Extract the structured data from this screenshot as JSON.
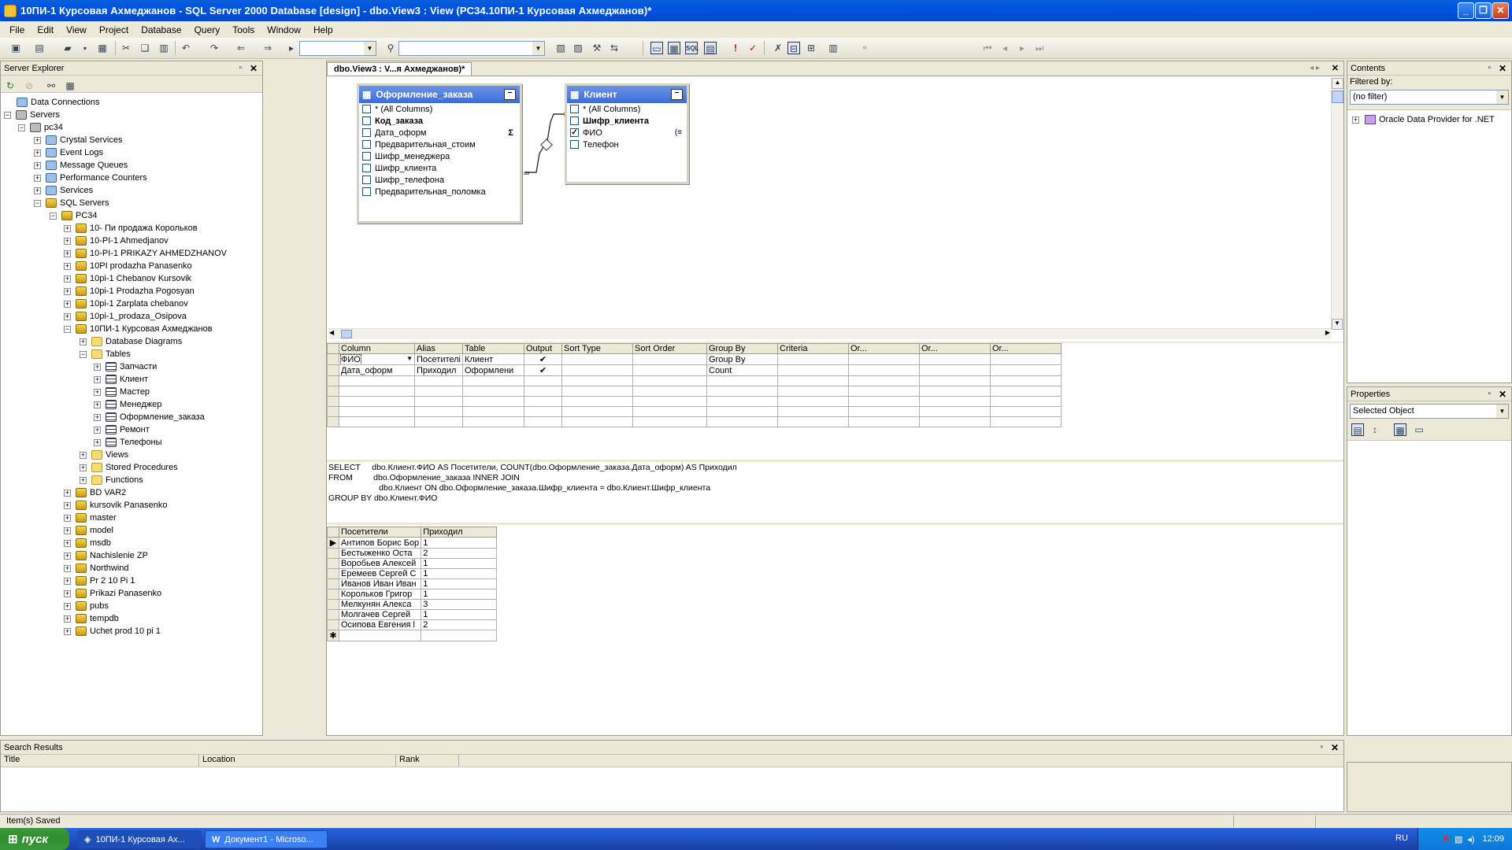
{
  "window": {
    "title": "10ПИ-1 Курсовая Ахмеджанов - SQL Server 2000 Database [design] - dbo.View3 : View (PC34.10ПИ-1 Курсовая Ахмеджанов)*"
  },
  "menu": [
    "File",
    "Edit",
    "View",
    "Project",
    "Database",
    "Query",
    "Tools",
    "Window",
    "Help"
  ],
  "server_explorer": {
    "title": "Server Explorer",
    "nodes": {
      "data_connections": "Data Connections",
      "servers": "Servers",
      "pc34": "pc34",
      "crystal": "Crystal Services",
      "event_logs": "Event Logs",
      "message_queues": "Message Queues",
      "perf": "Performance Counters",
      "services": "Services",
      "sql_servers": "SQL Servers",
      "pc34_inst": "PC34",
      "db1": "10- Пи продажа Корольков",
      "db2": "10-PI-1 Ahmedjanov",
      "db3": "10-PI-1 PRIKAZY AHMEDZHANOV",
      "db4": "10PI prodazha Panasenko",
      "db5": "10pi-1 Chebanov Kursovik",
      "db6": "10pi-1 Prodazha Pogosyan",
      "db7": "10pi-1 Zarplata chebanov",
      "db8": "10pi-1_prodaza_Osipova",
      "db9": "10ПИ-1 Курсовая Ахмеджанов",
      "diagrams": "Database Diagrams",
      "tables": "Tables",
      "t1": "Запчасти",
      "t2": "Клиент",
      "t3": "Мастер",
      "t4": "Менеджер",
      "t5": "Оформление_заказа",
      "t6": "Ремонт",
      "t7": "Телефоны",
      "views": "Views",
      "procs": "Stored Procedures",
      "funcs": "Functions",
      "db10": "BD VAR2",
      "db11": "kursovik Panasenko",
      "db12": "master",
      "db13": "model",
      "db14": "msdb",
      "db15": "Nachislenie ZP",
      "db16": "Northwind",
      "db17": "Pr 2 10 Pi 1",
      "db18": "Prikazi  Panasenko",
      "db19": "pubs",
      "db20": "tempdb",
      "db21": "Uchet prod 10 pi 1"
    }
  },
  "designer": {
    "tab": "dbo.View3 : V...я Ахмеджанов)*",
    "table1": {
      "title": "Оформление_заказа",
      "cols": [
        "* (All Columns)",
        "Код_заказа",
        "Дата_оформ",
        "Предварительная_стоим",
        "Шифр_менеджера",
        "Шифр_клиента",
        "Шифр_телефона",
        "Предварительная_поломка"
      ],
      "sigma": "Σ"
    },
    "table2": {
      "title": "Клиент",
      "cols": [
        "* (All Columns)",
        "Шифр_клиента",
        "ФИО",
        "Телефон"
      ]
    },
    "grid_headers": [
      "Column",
      "Alias",
      "Table",
      "Output",
      "Sort Type",
      "Sort Order",
      "Group By",
      "Criteria",
      "Or...",
      "Or...",
      "Or..."
    ],
    "grid_rows": [
      {
        "column": "ФИО",
        "alias": "Посетителі",
        "table": "Клиент",
        "output": "✔",
        "group": "Group By"
      },
      {
        "column": "Дата_оформ",
        "alias": "Приходил",
        "table": "Оформлени",
        "output": "✔",
        "group": "Count"
      }
    ],
    "sql": [
      "SELECT     dbo.Клиент.ФИО AS Посетители, COUNT(dbo.Оформление_заказа.Дата_оформ) AS Приходил",
      "FROM         dbo.Оформление_заказа INNER JOIN",
      "                      dbo.Клиент ON dbo.Оформление_заказа.Шифр_клиента = dbo.Клиент.Шифр_клиента",
      "GROUP BY dbo.Клиент.ФИО"
    ],
    "results_headers": [
      "Посетители",
      "Приходил"
    ],
    "results": [
      [
        "Антипов Борис Бор",
        "1"
      ],
      [
        "Бестыженко Оста",
        "2"
      ],
      [
        "Воробьев Алексей",
        "1"
      ],
      [
        "Еремеев Сергей С",
        "1"
      ],
      [
        "Иванов Иван Иван",
        "1"
      ],
      [
        "Корольков Григор",
        "1"
      ],
      [
        "Мелкунян Алекса",
        "3"
      ],
      [
        "Молгачев Сергей",
        "1"
      ],
      [
        "Осипова Евгения l",
        "2"
      ]
    ]
  },
  "contents": {
    "title": "Contents",
    "filtered_label": "Filtered by:",
    "filter_value": "(no filter)",
    "item": "Oracle Data Provider for .NET"
  },
  "properties": {
    "title": "Properties",
    "selected": "Selected Object"
  },
  "search": {
    "title": "Search Results",
    "cols": [
      "Title",
      "Location",
      "Rank"
    ]
  },
  "status": "Item(s) Saved",
  "taskbar": {
    "start": "пуск",
    "btn1": "10ПИ-1 Курсовая Ах...",
    "btn2": "Документ1 - Microso...",
    "lang": "RU",
    "clock": "12:09"
  }
}
